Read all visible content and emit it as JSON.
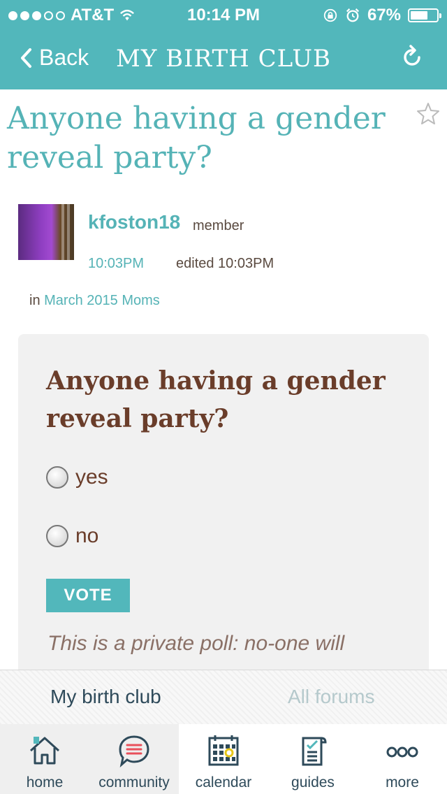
{
  "status": {
    "carrier": "AT&T",
    "time": "10:14 PM",
    "battery": "67%",
    "battery_level": 0.67
  },
  "nav": {
    "back_label": "Back",
    "title": "MY BIRTH CLUB"
  },
  "post": {
    "title": "Anyone having a gender reveal party?",
    "author": "kfoston18",
    "role": "member",
    "time": "10:03PM",
    "edited": "edited 10:03PM",
    "in_prefix": "in",
    "group": "March 2015 Moms"
  },
  "poll": {
    "question": "Anyone having a gender reveal party?",
    "options": [
      "yes",
      "no"
    ],
    "vote_label": "VOTE",
    "note": "This is a private poll: no-one will"
  },
  "forum_tabs": {
    "active": "My birth club",
    "inactive": "All forums"
  },
  "bottom_nav": {
    "items": [
      "home",
      "community",
      "calendar",
      "guides",
      "more"
    ]
  },
  "colors": {
    "accent": "#52b7bb",
    "brown": "#6a3d2a",
    "dark": "#2e4a5a"
  }
}
